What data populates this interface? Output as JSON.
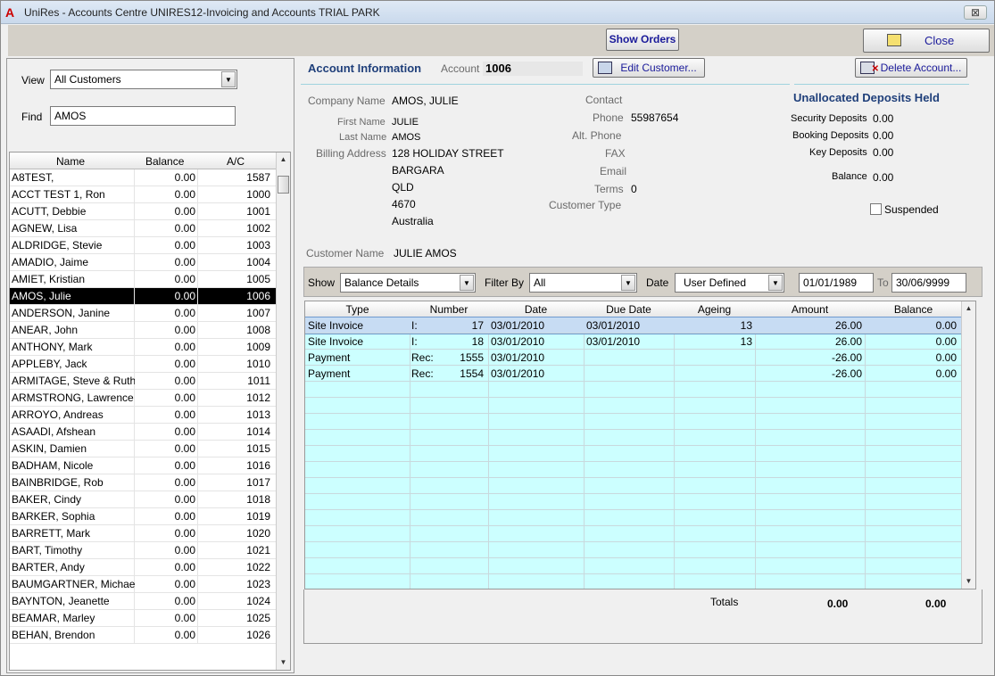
{
  "window": {
    "title": "UniRes - Accounts Centre UNIRES12-Invoicing and Accounts TRIAL PARK",
    "close_glyph": "⊠"
  },
  "toolbar": {
    "show_orders": "Show Orders",
    "close": "Close"
  },
  "left": {
    "view_label": "View",
    "view_value": "All Customers",
    "find_label": "Find",
    "find_value": "AMOS",
    "columns": {
      "name": "Name",
      "balance": "Balance",
      "ac": "A/C"
    },
    "rows": [
      {
        "name": "A8TEST,",
        "balance": "0.00",
        "ac": "1587"
      },
      {
        "name": "ACCT TEST 1, Ron",
        "balance": "0.00",
        "ac": "1000"
      },
      {
        "name": "ACUTT, Debbie",
        "balance": "0.00",
        "ac": "1001"
      },
      {
        "name": "AGNEW, Lisa",
        "balance": "0.00",
        "ac": "1002"
      },
      {
        "name": "ALDRIDGE, Stevie",
        "balance": "0.00",
        "ac": "1003"
      },
      {
        "name": "AMADIO, Jaime",
        "balance": "0.00",
        "ac": "1004"
      },
      {
        "name": "AMIET, Kristian",
        "balance": "0.00",
        "ac": "1005"
      },
      {
        "name": "AMOS, Julie",
        "balance": "0.00",
        "ac": "1006",
        "selected": true
      },
      {
        "name": "ANDERSON, Janine",
        "balance": "0.00",
        "ac": "1007"
      },
      {
        "name": "ANEAR, John",
        "balance": "0.00",
        "ac": "1008"
      },
      {
        "name": "ANTHONY, Mark",
        "balance": "0.00",
        "ac": "1009"
      },
      {
        "name": "APPLEBY, Jack",
        "balance": "0.00",
        "ac": "1010"
      },
      {
        "name": "ARMITAGE, Steve & Ruth",
        "balance": "0.00",
        "ac": "1011"
      },
      {
        "name": "ARMSTRONG, Lawrence",
        "balance": "0.00",
        "ac": "1012"
      },
      {
        "name": "ARROYO, Andreas",
        "balance": "0.00",
        "ac": "1013"
      },
      {
        "name": "ASAADI, Afshean",
        "balance": "0.00",
        "ac": "1014"
      },
      {
        "name": "ASKIN, Damien",
        "balance": "0.00",
        "ac": "1015"
      },
      {
        "name": "BADHAM, Nicole",
        "balance": "0.00",
        "ac": "1016"
      },
      {
        "name": "BAINBRIDGE, Rob",
        "balance": "0.00",
        "ac": "1017"
      },
      {
        "name": "BAKER, Cindy",
        "balance": "0.00",
        "ac": "1018"
      },
      {
        "name": "BARKER, Sophia",
        "balance": "0.00",
        "ac": "1019"
      },
      {
        "name": "BARRETT, Mark",
        "balance": "0.00",
        "ac": "1020"
      },
      {
        "name": "BART, Timothy",
        "balance": "0.00",
        "ac": "1021"
      },
      {
        "name": "BARTER, Andy",
        "balance": "0.00",
        "ac": "1022"
      },
      {
        "name": "BAUMGARTNER, Michael",
        "balance": "0.00",
        "ac": "1023"
      },
      {
        "name": "BAYNTON, Jeanette",
        "balance": "0.00",
        "ac": "1024"
      },
      {
        "name": "BEAMAR, Marley",
        "balance": "0.00",
        "ac": "1025"
      },
      {
        "name": "BEHAN, Brendon",
        "balance": "0.00",
        "ac": "1026"
      }
    ]
  },
  "account": {
    "section_title": "Account Information",
    "account_label": "Account",
    "account_no": "1006",
    "edit_button": "Edit Customer...",
    "delete_button": "Delete Account...",
    "company_label": "Company Name",
    "company": "AMOS, JULIE",
    "first_label": "First Name",
    "first": "JULIE",
    "last_label": "Last Name",
    "last": "AMOS",
    "billing_label": "Billing Address",
    "addr1": "128 HOLIDAY STREET",
    "addr2": "BARGARA",
    "addr3": "QLD",
    "addr4": "4670",
    "addr5": "Australia",
    "contact_label": "Contact",
    "phone_label": "Phone",
    "phone": "55987654",
    "alt_phone_label": "Alt. Phone",
    "fax_label": "FAX",
    "email_label": "Email",
    "terms_label": "Terms",
    "terms": "0",
    "type_label": "Customer Type",
    "cust_name_label": "Customer Name",
    "cust_name": "JULIE AMOS"
  },
  "deposits": {
    "title": "Unallocated Deposits Held",
    "security_label": "Security Deposits",
    "security": "0.00",
    "booking_label": "Booking Deposits",
    "booking": "0.00",
    "key_label": "Key Deposits",
    "key": "0.00",
    "balance_label": "Balance",
    "balance": "0.00",
    "suspended_label": "Suspended"
  },
  "filters": {
    "show_label": "Show",
    "show_value": "Balance Details",
    "filter_label": "Filter By",
    "filter_value": "All",
    "date_label": "Date",
    "date_value": "User Defined",
    "from": "01/01/1989",
    "to_label": "To",
    "to": "30/06/9999"
  },
  "grid": {
    "columns": [
      "Type",
      "Number",
      "Date",
      "Due Date",
      "Ageing",
      "Amount",
      "Balance"
    ],
    "rows": [
      {
        "type": "Site Invoice",
        "prefix": "I:",
        "num": "17",
        "date": "03/01/2010",
        "due": "03/01/2010",
        "ageing": "13",
        "amount": "26.00",
        "balance": "0.00",
        "selected": true
      },
      {
        "type": "Site Invoice",
        "prefix": "I:",
        "num": "18",
        "date": "03/01/2010",
        "due": "03/01/2010",
        "ageing": "13",
        "amount": "26.00",
        "balance": "0.00"
      },
      {
        "type": "Payment",
        "prefix": "Rec:",
        "num": "1555",
        "date": "03/01/2010",
        "due": "",
        "ageing": "",
        "amount": "-26.00",
        "balance": "0.00"
      },
      {
        "type": "Payment",
        "prefix": "Rec:",
        "num": "1554",
        "date": "03/01/2010",
        "due": "",
        "ageing": "",
        "amount": "-26.00",
        "balance": "0.00"
      }
    ],
    "totals_label": "Totals",
    "total_amount": "0.00",
    "total_balance": "0.00"
  }
}
